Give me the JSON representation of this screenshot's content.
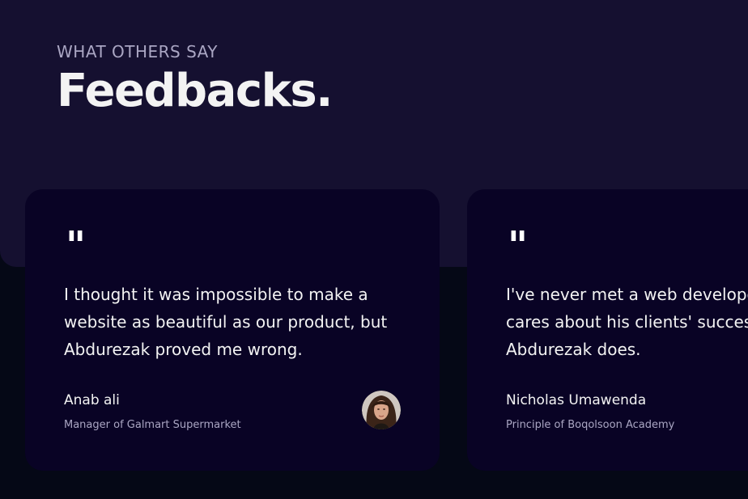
{
  "header": {
    "subtitle": "WHAT OTHERS SAY",
    "title": "Feedbacks."
  },
  "testimonials": [
    {
      "quote_mark": "\"",
      "text": "I thought it was impossible to make a website as beautiful as our product, but Abdurezak proved me wrong.",
      "name": "Anab ali",
      "role": "Manager of Galmart Supermarket",
      "has_avatar": true
    },
    {
      "quote_mark": "\"",
      "text": "I've never met a web developer who truly cares about his clients' success like Abdurezak does.",
      "name": "Nicholas Umawenda",
      "role": "Principle of Boqolsoon Academy",
      "has_avatar": false
    }
  ],
  "colors": {
    "page_background": "#050816",
    "header_panel": "#151030",
    "card_background": "#090325",
    "primary_text": "#f3f3f3",
    "secondary_text": "#aaa6c3"
  }
}
